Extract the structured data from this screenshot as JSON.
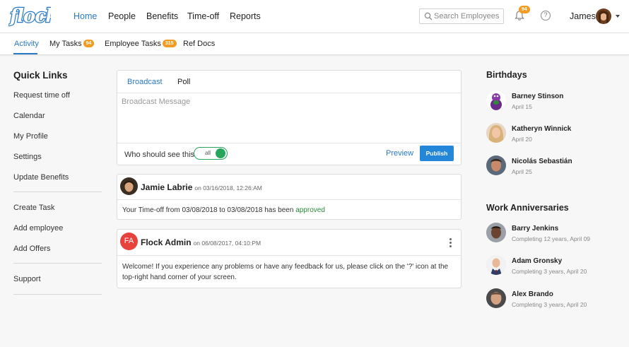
{
  "app": {
    "brand": "flock",
    "brand_color": "#2a79c8",
    "accent_orange": "#f39c21",
    "success_green": "#26a65b"
  },
  "nav": {
    "items": [
      {
        "label": "Home",
        "active": true
      },
      {
        "label": "People"
      },
      {
        "label": "Benefits"
      },
      {
        "label": "Time-off"
      },
      {
        "label": "Reports"
      }
    ]
  },
  "search": {
    "placeholder": "Search Employees",
    "icon": "search-icon"
  },
  "notifications": {
    "count": "94",
    "icon": "bell-icon"
  },
  "help": {
    "label": "?"
  },
  "user": {
    "name": "James"
  },
  "subnav": {
    "tabs": [
      {
        "label": "Activity",
        "active": true
      },
      {
        "label": "My Tasks",
        "badge": "94"
      },
      {
        "label": "Employee Tasks",
        "badge": "315"
      },
      {
        "label": "Ref Docs"
      }
    ]
  },
  "quick_links": {
    "title": "Quick Links",
    "group1": [
      "Request time off",
      "Calendar",
      "My Profile",
      "Settings",
      "Update Benefits"
    ],
    "group2": [
      "Create Task",
      "Add employee",
      "Add Offers"
    ],
    "group3": [
      "Support"
    ]
  },
  "broadcast": {
    "tabs": [
      "Broadcast",
      "Poll"
    ],
    "placeholder": "Broadcast Message",
    "who_label": "Who should see this?",
    "audience": "all",
    "preview": "Preview",
    "publish": "Publish"
  },
  "posts": [
    {
      "author": "Jamie Labrie",
      "date": "on 03/16/2018, 12:26:AM",
      "body_pre": "Your Time-off from 03/08/2018 to 03/08/2018 has been",
      "status": "approved"
    },
    {
      "author": "Flock Admin",
      "initials": "FA",
      "date": "on 06/08/2017, 04:10:PM",
      "body_line1": "Welcome! If you experience any problems or have any feedback for us, please click on the '?' icon at the",
      "body_line2": "top-right hand corner of your screen."
    }
  ],
  "birthdays": {
    "title": "Birthdays",
    "people": [
      {
        "name": "Barney Stinson",
        "date": "April 15"
      },
      {
        "name": "Katheryn Winnick",
        "date": "April 20"
      },
      {
        "name": "Nicolás Sebastián",
        "date": "April 25"
      }
    ]
  },
  "anniversaries": {
    "title": "Work Anniversaries",
    "people": [
      {
        "name": "Barry Jenkins",
        "detail": "Completing 12 years, April 09"
      },
      {
        "name": "Adam Gronsky",
        "detail": "Completing 3 years, April 20"
      },
      {
        "name": "Alex Brando",
        "detail": "Completing 3 years, April 20"
      }
    ]
  }
}
